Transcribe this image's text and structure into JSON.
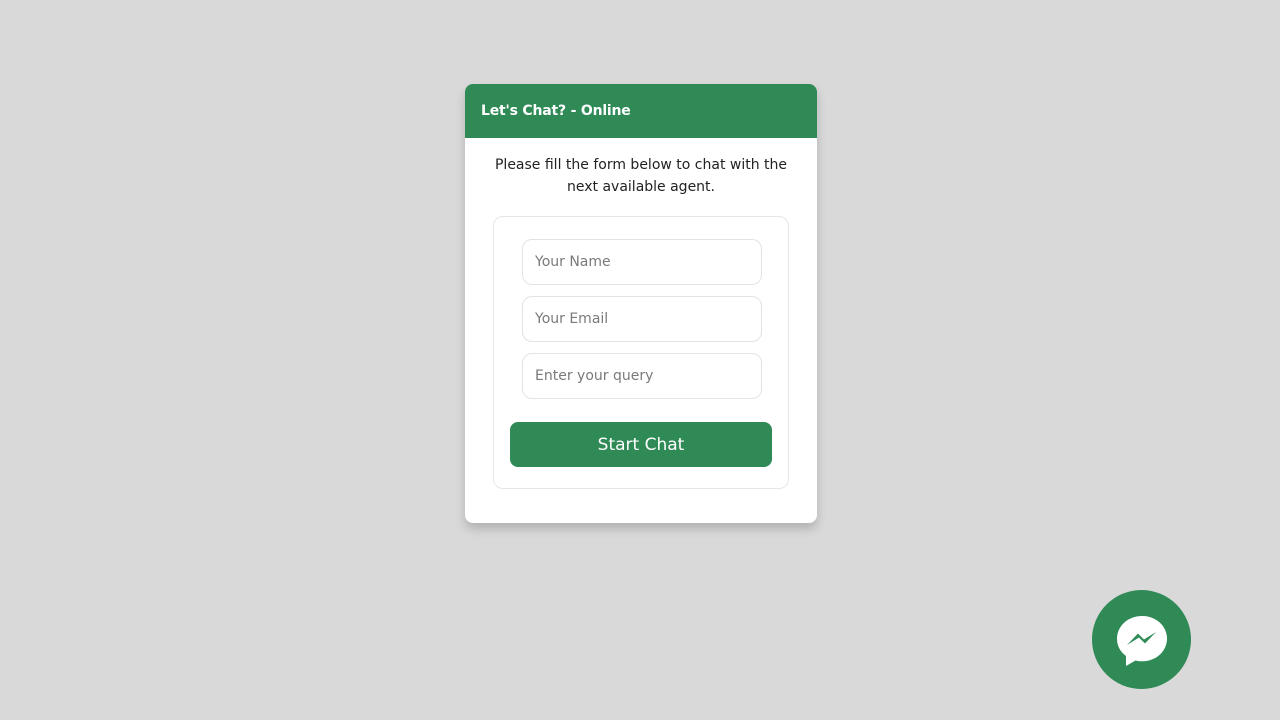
{
  "chat": {
    "title": "Let's Chat? - Online",
    "intro": "Please fill the form below to chat with the next available agent.",
    "form": {
      "name_placeholder": "Your Name",
      "email_placeholder": "Your Email",
      "query_placeholder": "Enter your query",
      "start_label": "Start Chat"
    }
  },
  "fab": {
    "icon": "messenger-icon"
  },
  "colors": {
    "background": "#d9d9d9",
    "accent": "#2f8a56",
    "card": "#ffffff"
  }
}
